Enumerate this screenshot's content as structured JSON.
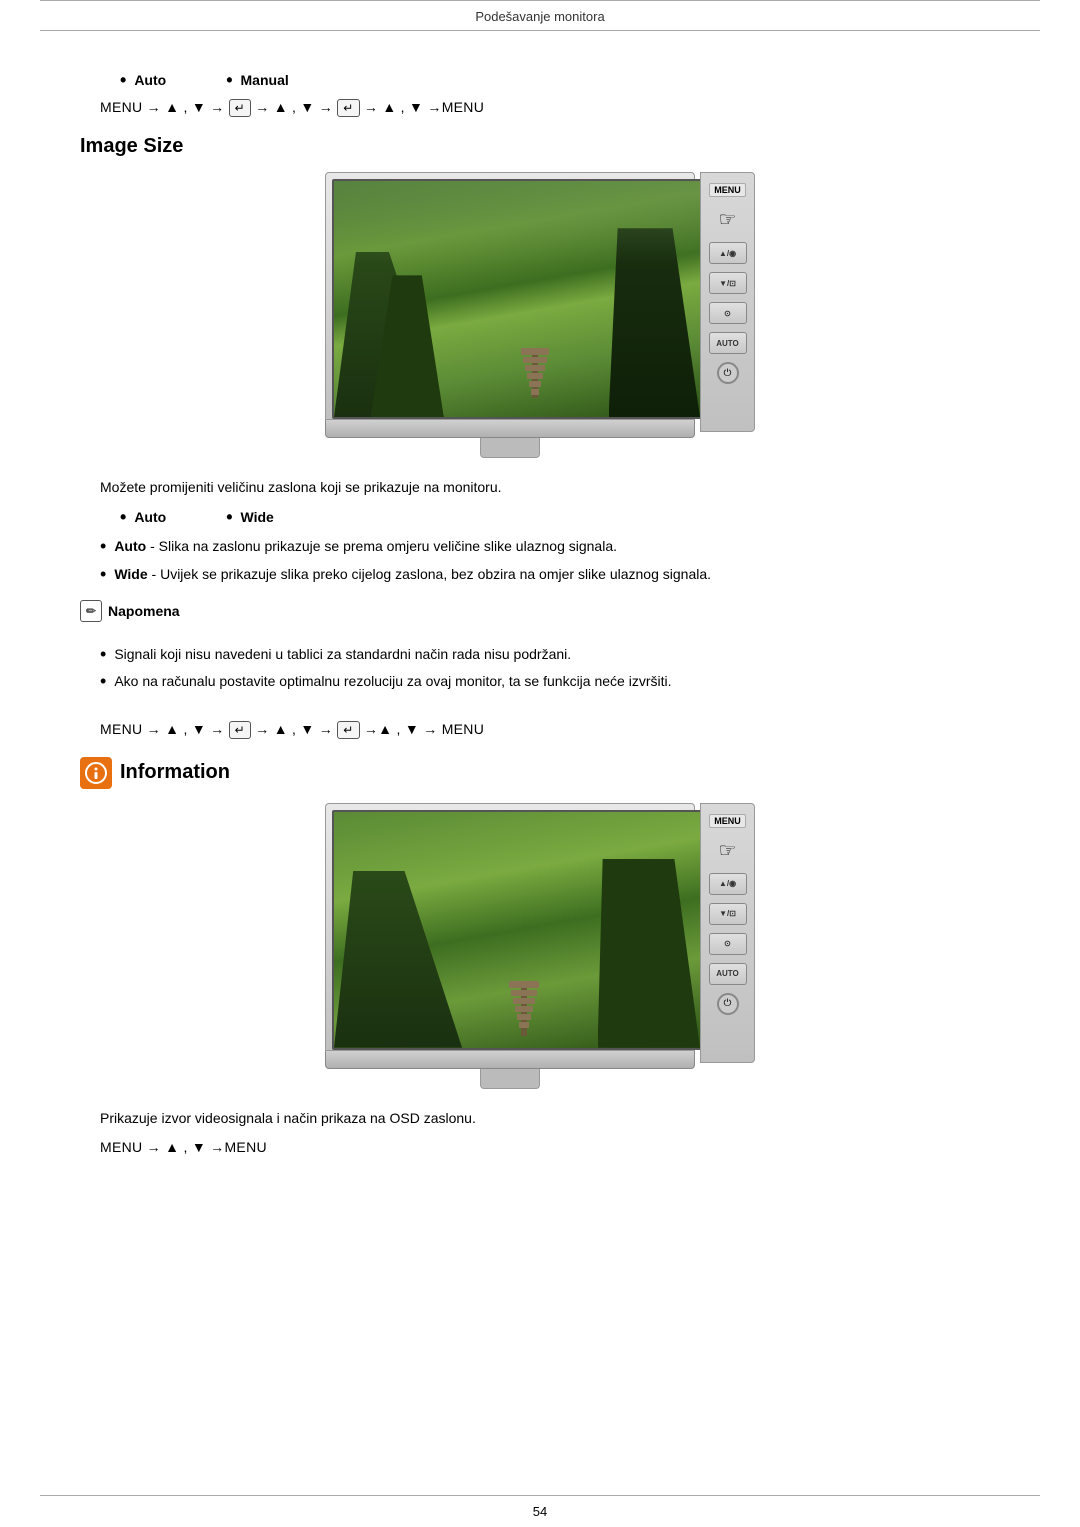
{
  "header": {
    "title": "Podešavanje monitora"
  },
  "section1": {
    "bullets": [
      "Auto",
      "Manual"
    ],
    "nav1": "MENU → ▲ , ▼ → ↵ → ▲ , ▼ → ↵ → ▲ , ▼ →MENU"
  },
  "image_size_section": {
    "title": "Image Size",
    "description": "Možete promijeniti veličinu zaslona koji se prikazuje na monitoru.",
    "bullets_simple": [
      "Auto",
      "Wide"
    ],
    "bullet_details": [
      {
        "bold": "Auto",
        "text": "- Slika na zaslonu prikazuje se prema omjeru veličine slike ulaznog signala."
      },
      {
        "bold": "Wide",
        "text": "- Uvijek se prikazuje slika preko cijelog zaslona, bez obzira na omjer slike ulaznog signala."
      }
    ],
    "note_label": "Napomena",
    "note_items": [
      "Signali koji nisu navedeni u tablici za standardni način rada nisu podržani.",
      "Ako na računalu postavite optimalnu rezoluciju za ovaj monitor, ta se funkcija neće izvršiti."
    ],
    "nav2": "MENU → ▲ , ▼ → ↵ → ▲ , ▼ → ↵ →▲ , ▼ → MENU"
  },
  "information_section": {
    "title": "Information",
    "description": "Prikazuje izvor videosignala i način prikaza na OSD zaslonu.",
    "nav": "MENU → ▲ , ▼ →MENU"
  },
  "footer": {
    "page_number": "54"
  },
  "monitor_buttons": {
    "menu_label": "MENU",
    "up_label": "▲/◉",
    "down_label": "▼/⊡",
    "enter_label": "⊙",
    "auto_label": "AUTO",
    "power_label": "⏻"
  }
}
